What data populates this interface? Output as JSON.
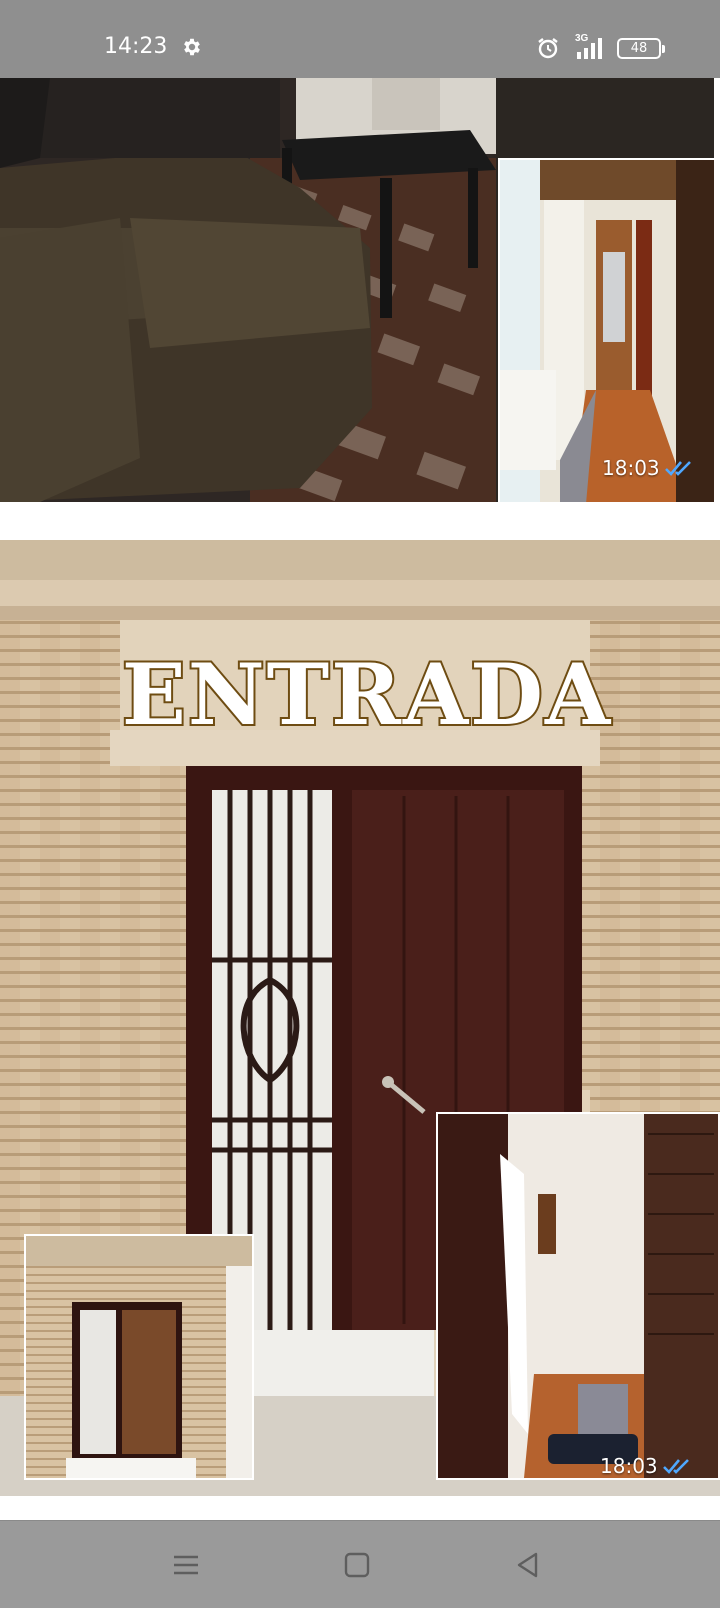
{
  "status_bar": {
    "time": "14:23",
    "network": "3G",
    "battery": "48",
    "icons": [
      "gear-icon",
      "alarm-icon",
      "signal-icon",
      "battery-icon"
    ]
  },
  "chat": {
    "messages": [
      {
        "type": "image-album",
        "timestamp": "18:03",
        "read": true,
        "photos": [
          "living-room-sofa",
          "hallway"
        ]
      },
      {
        "type": "image-album",
        "overlay_text": "ENTRADA",
        "timestamp": "18:03",
        "read": true,
        "photos": [
          "entrance-door",
          "entrance-small",
          "entrance-interior"
        ]
      }
    ]
  },
  "nav_bar": {
    "buttons": [
      "menu-icon",
      "home-icon",
      "back-icon"
    ]
  },
  "colors": {
    "status_bar_bg": "#8f8f8f",
    "nav_bar_bg": "#9a9a9a",
    "read_ticks": "#4fa8ff",
    "title_outline": "#6e4c12"
  }
}
